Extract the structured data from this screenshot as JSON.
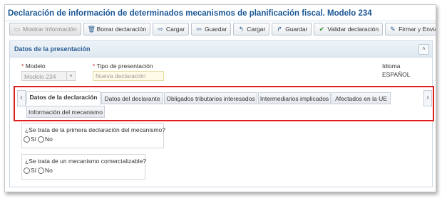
{
  "window": {
    "title": "Declaración de información de determinados mecanismos de planificación fiscal. Modelo 234"
  },
  "toolbar": {
    "buttons": [
      {
        "label": "Mostrar Información",
        "icon": "info-icon",
        "enabled": false
      },
      {
        "label": "Borrar declaración",
        "icon": "trash-icon",
        "enabled": true
      },
      {
        "label": "Cargar",
        "icon": "load-icon",
        "enabled": true
      },
      {
        "label": "Guardar",
        "icon": "save-icon",
        "enabled": true
      },
      {
        "label": "Cargar",
        "icon": "upload-icon",
        "enabled": true
      },
      {
        "label": "Guardar",
        "icon": "download-icon",
        "enabled": true
      },
      {
        "label": "Validar declaración",
        "icon": "check-icon",
        "enabled": true
      },
      {
        "label": "Firmar y Enviar",
        "icon": "sign-icon",
        "enabled": true
      }
    ]
  },
  "presentation": {
    "header": "Datos de la presentación",
    "collapse_symbol": "˄",
    "modelo": {
      "label": "Modelo",
      "value": "Modelo 234"
    },
    "tipo": {
      "label": "Tipo de presentación",
      "placeholder": "Nueva declaración"
    },
    "idioma": {
      "label": "Idioma",
      "value": "ESPAÑOL"
    },
    "required_mark": "*"
  },
  "tabs": {
    "prev_arrow": "‹",
    "next_arrow": "›",
    "items": [
      {
        "label": "Datos de la declaración",
        "active": true
      },
      {
        "label": "Datos del declarante",
        "active": false
      },
      {
        "label": "Obligados tributarios interesados",
        "active": false
      },
      {
        "label": "Intermediarios implicados",
        "active": false
      },
      {
        "label": "Afectados en la UE",
        "active": false
      },
      {
        "label": "Información del mecanismo",
        "active": false
      }
    ]
  },
  "questions": [
    {
      "text": "¿Se trata de la primera declaración del mecanismo?",
      "options": [
        "Sí",
        "No"
      ]
    },
    {
      "text": "¿Se trata de un mecanismo comercializable?",
      "options": [
        "Sí",
        "No"
      ]
    }
  ],
  "colors": {
    "title": "#1a5694",
    "highlight": "#e01e1e",
    "required": "#d02020"
  }
}
